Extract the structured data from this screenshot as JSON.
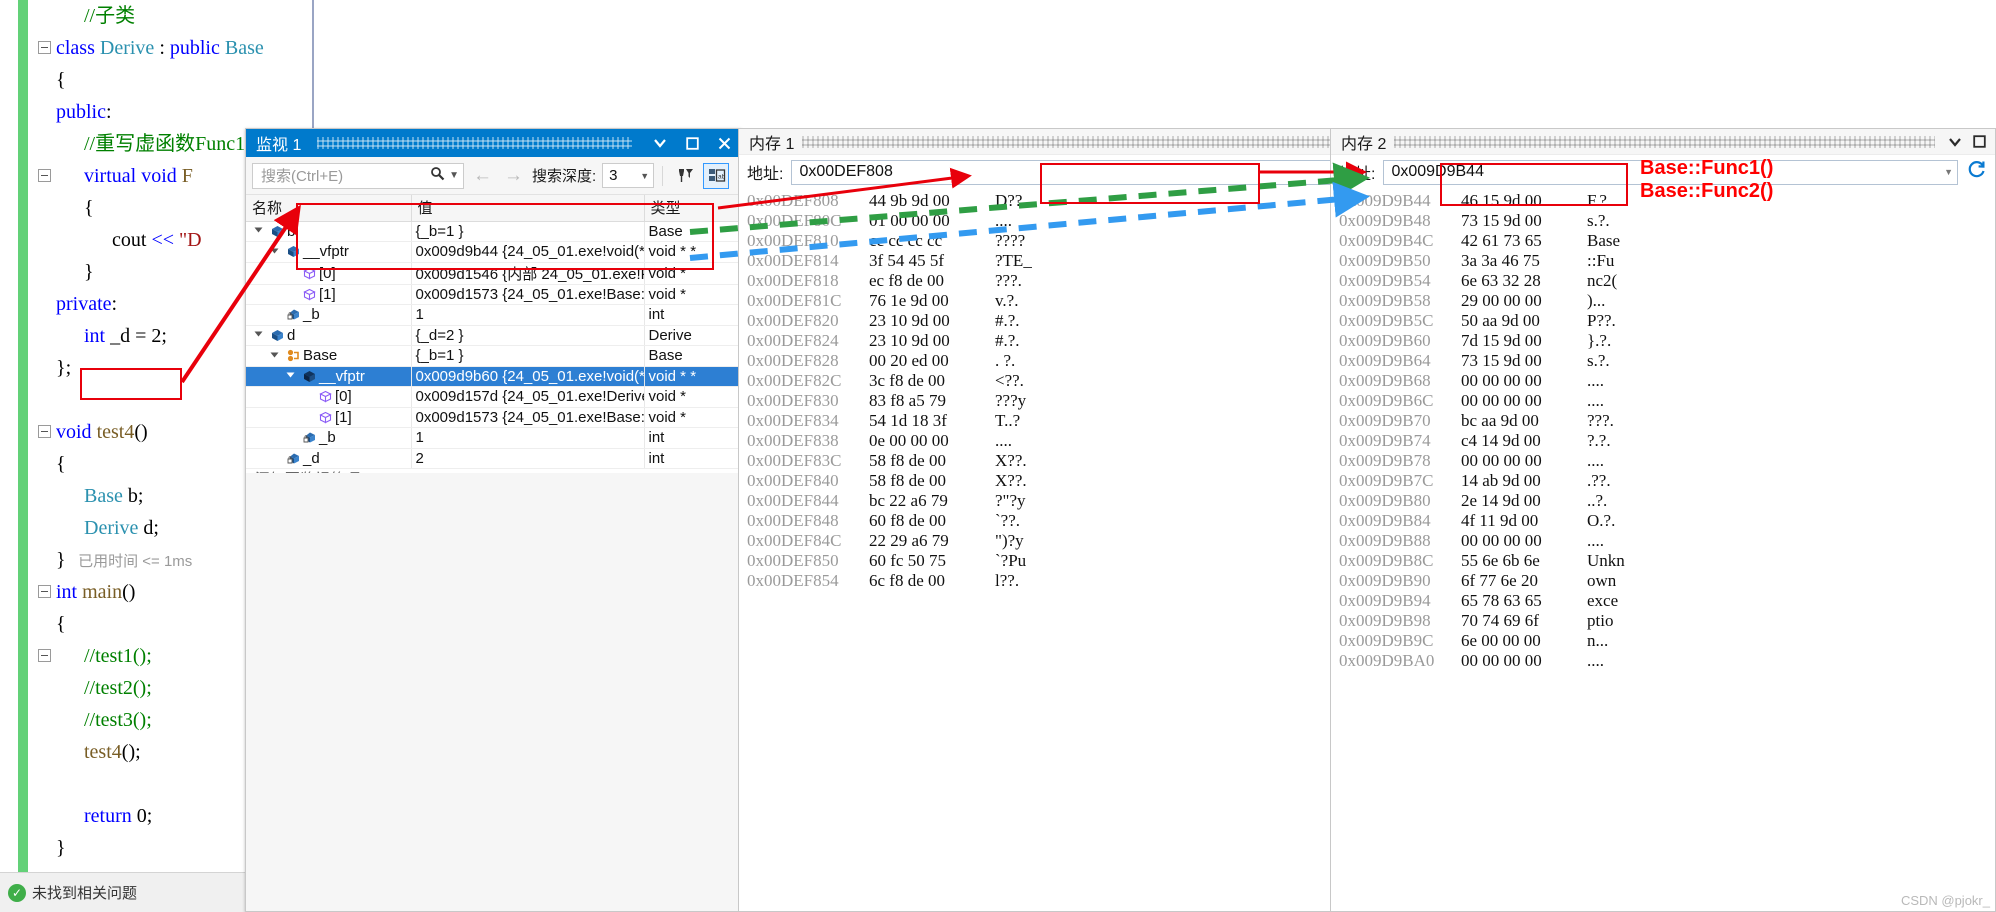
{
  "editor": {
    "lines": [
      {
        "indent": 1,
        "segs": [
          {
            "t": "//子类",
            "c": "cmt"
          }
        ]
      },
      {
        "indent": 0,
        "fold": true,
        "segs": [
          {
            "t": "class ",
            "c": "kw"
          },
          {
            "t": "Derive ",
            "c": "typ"
          },
          {
            "t": ": ",
            "c": "op"
          },
          {
            "t": "public ",
            "c": "kw"
          },
          {
            "t": "Base",
            "c": "typ"
          }
        ]
      },
      {
        "indent": 0,
        "segs": [
          {
            "t": "{",
            "c": "op"
          }
        ]
      },
      {
        "indent": 0,
        "segs": [
          {
            "t": "public",
            "c": "kw"
          },
          {
            "t": ":",
            "c": "op"
          }
        ]
      },
      {
        "indent": 1,
        "segs": [
          {
            "t": "//重写虚函数Func1",
            "c": "cmt"
          }
        ]
      },
      {
        "indent": 1,
        "fold": true,
        "segs": [
          {
            "t": "virtual ",
            "c": "kw"
          },
          {
            "t": "void ",
            "c": "kw"
          },
          {
            "t": "F",
            "c": "fn"
          }
        ]
      },
      {
        "indent": 1,
        "segs": [
          {
            "t": "{",
            "c": "op"
          }
        ]
      },
      {
        "indent": 2,
        "segs": [
          {
            "t": "cout ",
            "c": "op"
          },
          {
            "t": "<< ",
            "c": "kw"
          },
          {
            "t": "\"D",
            "c": "str"
          }
        ]
      },
      {
        "indent": 1,
        "segs": [
          {
            "t": "}",
            "c": "op"
          }
        ]
      },
      {
        "indent": 0,
        "segs": [
          {
            "t": "private",
            "c": "kw"
          },
          {
            "t": ":",
            "c": "op"
          }
        ]
      },
      {
        "indent": 1,
        "segs": [
          {
            "t": "int ",
            "c": "kw"
          },
          {
            "t": "_d = ",
            "c": "op"
          },
          {
            "t": "2",
            "c": "num"
          },
          {
            "t": ";",
            "c": "op"
          }
        ]
      },
      {
        "indent": 0,
        "segs": [
          {
            "t": "};",
            "c": "op"
          }
        ]
      },
      {
        "indent": 0,
        "segs": [
          {
            "t": "",
            "c": "op"
          }
        ]
      },
      {
        "indent": 0,
        "fold": true,
        "segs": [
          {
            "t": "void ",
            "c": "kw"
          },
          {
            "t": "test4",
            "c": "fn"
          },
          {
            "t": "()",
            "c": "op"
          }
        ]
      },
      {
        "indent": 0,
        "segs": [
          {
            "t": "{",
            "c": "op"
          }
        ]
      },
      {
        "indent": 1,
        "segs": [
          {
            "t": "Base ",
            "c": "typ"
          },
          {
            "t": "b;",
            "c": "op"
          }
        ]
      },
      {
        "indent": 1,
        "segs": [
          {
            "t": "Derive ",
            "c": "typ"
          },
          {
            "t": "d;",
            "c": "op"
          }
        ]
      },
      {
        "indent": 0,
        "segs": [
          {
            "t": "}",
            "c": "op"
          },
          {
            "t": "   已用时间 <= 1ms",
            "c": "dim"
          }
        ]
      },
      {
        "indent": 0,
        "fold": true,
        "segs": [
          {
            "t": "int ",
            "c": "kw"
          },
          {
            "t": "main",
            "c": "fn"
          },
          {
            "t": "()",
            "c": "op"
          }
        ]
      },
      {
        "indent": 0,
        "segs": [
          {
            "t": "{",
            "c": "op"
          }
        ]
      },
      {
        "indent": 1,
        "fold": true,
        "segs": [
          {
            "t": "//test1();",
            "c": "cmt"
          }
        ]
      },
      {
        "indent": 1,
        "segs": [
          {
            "t": "//test2();",
            "c": "cmt"
          }
        ]
      },
      {
        "indent": 1,
        "segs": [
          {
            "t": "//test3();",
            "c": "cmt"
          }
        ]
      },
      {
        "indent": 1,
        "segs": [
          {
            "t": "test4",
            "c": "fn"
          },
          {
            "t": "();",
            "c": "op"
          }
        ]
      },
      {
        "indent": 1,
        "segs": [
          {
            "t": "",
            "c": "op"
          }
        ]
      },
      {
        "indent": 1,
        "segs": [
          {
            "t": "return ",
            "c": "kw"
          },
          {
            "t": "0",
            "c": "num"
          },
          {
            "t": ";",
            "c": "op"
          }
        ]
      },
      {
        "indent": 0,
        "segs": [
          {
            "t": "}",
            "c": "op"
          }
        ]
      }
    ],
    "status": "未找到相关问题"
  },
  "watch": {
    "title": "监视 1",
    "search_placeholder": "搜索(Ctrl+E)",
    "depth_label": "搜索深度:",
    "depth_value": "3",
    "columns": [
      "名称",
      "值",
      "类型"
    ],
    "add_item_label": "添加要监视的项",
    "rows": [
      {
        "indent": 0,
        "exp": true,
        "icon": "cube-blue",
        "name": "b",
        "value": "{_b=1 }",
        "type": "Base",
        "sel": false
      },
      {
        "indent": 1,
        "exp": true,
        "icon": "cube-blue",
        "name": "__vfptr",
        "value": "0x009d9b44 {24_05_01.exe!void(* ...",
        "type": "void * *",
        "sel": false
      },
      {
        "indent": 2,
        "exp": false,
        "icon": "cube-purple",
        "name": "[0]",
        "value": "0x009d1546 {内部 24_05_01.exe!P...",
        "type": "void *",
        "sel": false
      },
      {
        "indent": 2,
        "exp": false,
        "icon": "cube-purple",
        "name": "[1]",
        "value": "0x009d1573 {24_05_01.exe!Base::F...",
        "type": "void *",
        "sel": false
      },
      {
        "indent": 1,
        "exp": false,
        "icon": "lock-field",
        "name": "_b",
        "value": "1",
        "type": "int",
        "sel": false
      },
      {
        "indent": 0,
        "exp": true,
        "icon": "cube-blue",
        "name": "d",
        "value": "{_d=2 }",
        "type": "Derive",
        "sel": false
      },
      {
        "indent": 1,
        "exp": true,
        "icon": "base-orange",
        "name": "Base",
        "value": "{_b=1 }",
        "type": "Base",
        "sel": false
      },
      {
        "indent": 2,
        "exp": true,
        "icon": "cube-dark",
        "name": "__vfptr",
        "value": "0x009d9b60 {24_05_01.exe!void(* ...",
        "type": "void * *",
        "sel": true
      },
      {
        "indent": 3,
        "exp": false,
        "icon": "cube-purple",
        "name": "[0]",
        "value": "0x009d157d {24_05_01.exe!Derive::...",
        "type": "void *",
        "sel": false
      },
      {
        "indent": 3,
        "exp": false,
        "icon": "cube-purple",
        "name": "[1]",
        "value": "0x009d1573 {24_05_01.exe!Base::F...",
        "type": "void *",
        "sel": false
      },
      {
        "indent": 2,
        "exp": false,
        "icon": "lock-field",
        "name": "_b",
        "value": "1",
        "type": "int",
        "sel": false
      },
      {
        "indent": 1,
        "exp": false,
        "icon": "lock-field",
        "name": "_d",
        "value": "2",
        "type": "int",
        "sel": false
      }
    ]
  },
  "memory1": {
    "title": "内存 1",
    "address_label": "地址:",
    "address_value": "0x00DEF808",
    "rows": [
      {
        "addr": "0x00DEF808",
        "hex": "44 9b 9d 00",
        "ascii": "D??."
      },
      {
        "addr": "0x00DEF80C",
        "hex": "01 00 00 00",
        "ascii": "...."
      },
      {
        "addr": "0x00DEF810",
        "hex": "cc cc cc cc",
        "ascii": "????"
      },
      {
        "addr": "0x00DEF814",
        "hex": "3f 54 45 5f",
        "ascii": "?TE_"
      },
      {
        "addr": "0x00DEF818",
        "hex": "ec f8 de 00",
        "ascii": "???."
      },
      {
        "addr": "0x00DEF81C",
        "hex": "76 1e 9d 00",
        "ascii": "v.?."
      },
      {
        "addr": "0x00DEF820",
        "hex": "23 10 9d 00",
        "ascii": "#.?."
      },
      {
        "addr": "0x00DEF824",
        "hex": "23 10 9d 00",
        "ascii": "#.?."
      },
      {
        "addr": "0x00DEF828",
        "hex": "00 20 ed 00",
        "ascii": ". ?."
      },
      {
        "addr": "0x00DEF82C",
        "hex": "3c f8 de 00",
        "ascii": "<??."
      },
      {
        "addr": "0x00DEF830",
        "hex": "83 f8 a5 79",
        "ascii": "???y"
      },
      {
        "addr": "0x00DEF834",
        "hex": "54 1d 18 3f",
        "ascii": "T..?"
      },
      {
        "addr": "0x00DEF838",
        "hex": "0e 00 00 00",
        "ascii": "...."
      },
      {
        "addr": "0x00DEF83C",
        "hex": "58 f8 de 00",
        "ascii": "X??."
      },
      {
        "addr": "0x00DEF840",
        "hex": "58 f8 de 00",
        "ascii": "X??."
      },
      {
        "addr": "0x00DEF844",
        "hex": "bc 22 a6 79",
        "ascii": "?\"?y"
      },
      {
        "addr": "0x00DEF848",
        "hex": "60 f8 de 00",
        "ascii": "`??."
      },
      {
        "addr": "0x00DEF84C",
        "hex": "22 29 a6 79",
        "ascii": "\")?y"
      },
      {
        "addr": "0x00DEF850",
        "hex": "60 fc 50 75",
        "ascii": "`?Pu"
      },
      {
        "addr": "0x00DEF854",
        "hex": "6c f8 de 00",
        "ascii": "l??."
      }
    ]
  },
  "memory2": {
    "title": "内存 2",
    "address_label": "地址:",
    "address_value": "0x009D9B44",
    "rows": [
      {
        "addr": "0x009D9B44",
        "hex": "46 15 9d 00",
        "ascii": "F.?."
      },
      {
        "addr": "0x009D9B48",
        "hex": "73 15 9d 00",
        "ascii": "s.?."
      },
      {
        "addr": "0x009D9B4C",
        "hex": "42 61 73 65",
        "ascii": "Base"
      },
      {
        "addr": "0x009D9B50",
        "hex": "3a 3a 46 75",
        "ascii": "::Fu"
      },
      {
        "addr": "0x009D9B54",
        "hex": "6e 63 32 28",
        "ascii": "nc2("
      },
      {
        "addr": "0x009D9B58",
        "hex": "29 00 00 00",
        "ascii": ")..."
      },
      {
        "addr": "0x009D9B5C",
        "hex": "50 aa 9d 00",
        "ascii": "P??."
      },
      {
        "addr": "0x009D9B60",
        "hex": "7d 15 9d 00",
        "ascii": "}.?."
      },
      {
        "addr": "0x009D9B64",
        "hex": "73 15 9d 00",
        "ascii": "s.?."
      },
      {
        "addr": "0x009D9B68",
        "hex": "00 00 00 00",
        "ascii": "...."
      },
      {
        "addr": "0x009D9B6C",
        "hex": "00 00 00 00",
        "ascii": "...."
      },
      {
        "addr": "0x009D9B70",
        "hex": "bc aa 9d 00",
        "ascii": "???."
      },
      {
        "addr": "0x009D9B74",
        "hex": "c4 14 9d 00",
        "ascii": "?.?."
      },
      {
        "addr": "0x009D9B78",
        "hex": "00 00 00 00",
        "ascii": "...."
      },
      {
        "addr": "0x009D9B7C",
        "hex": "14 ab 9d 00",
        "ascii": ".??."
      },
      {
        "addr": "0x009D9B80",
        "hex": "2e 14 9d 00",
        "ascii": "..?."
      },
      {
        "addr": "0x009D9B84",
        "hex": "4f 11 9d 00",
        "ascii": "O.?."
      },
      {
        "addr": "0x009D9B88",
        "hex": "00 00 00 00",
        "ascii": "...."
      },
      {
        "addr": "0x009D9B8C",
        "hex": "55 6e 6b 6e",
        "ascii": "Unkn"
      },
      {
        "addr": "0x009D9B90",
        "hex": "6f 77 6e 20",
        "ascii": "own "
      },
      {
        "addr": "0x009D9B94",
        "hex": "65 78 63 65",
        "ascii": "exce"
      },
      {
        "addr": "0x009D9B98",
        "hex": "70 74 69 6f",
        "ascii": "ptio"
      },
      {
        "addr": "0x009D9B9C",
        "hex": "6e 00 00 00",
        "ascii": "n..."
      },
      {
        "addr": "0x009D9BA0",
        "hex": "00 00 00 00",
        "ascii": "...."
      }
    ]
  },
  "annotations": {
    "func1_label": "Base::Func1()",
    "func2_label": "Base::Func2()",
    "accent_red": "#ff0000",
    "accent_green": "#2f9e44",
    "accent_blue": "#339af0",
    "box_red": "#e8000b"
  },
  "watermark": "CSDN @pjokr_"
}
